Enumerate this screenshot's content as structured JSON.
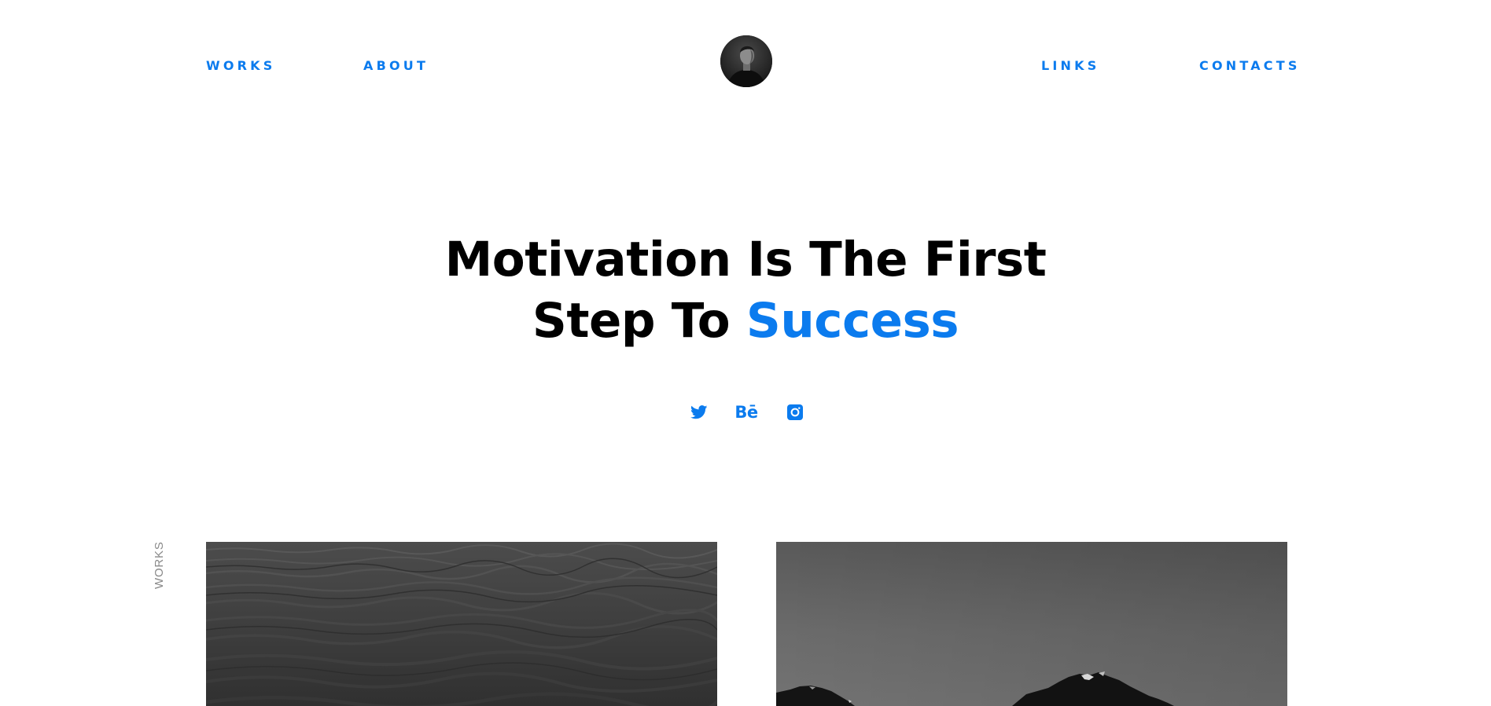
{
  "nav": {
    "left": [
      "WORKS",
      "ABOUT"
    ],
    "right": [
      "LINKS",
      "CONTACTS"
    ]
  },
  "avatar": {
    "icon": "profile-portrait"
  },
  "hero": {
    "line1": "Motivation Is The First",
    "line2_prefix": "Step To ",
    "line2_accent": "Success"
  },
  "socials": [
    {
      "icon": "twitter-icon"
    },
    {
      "icon": "behance-icon",
      "glyph": "Bē"
    },
    {
      "icon": "instagram-icon"
    }
  ],
  "works": {
    "side_label": "WORKS",
    "items": [
      {
        "image": "sea-waves-photo"
      },
      {
        "image": "mountain-peaks-photo"
      }
    ]
  },
  "colors": {
    "accent": "#0b7bee",
    "text": "#000000",
    "muted": "#8a8a8a",
    "background": "#ffffff"
  }
}
